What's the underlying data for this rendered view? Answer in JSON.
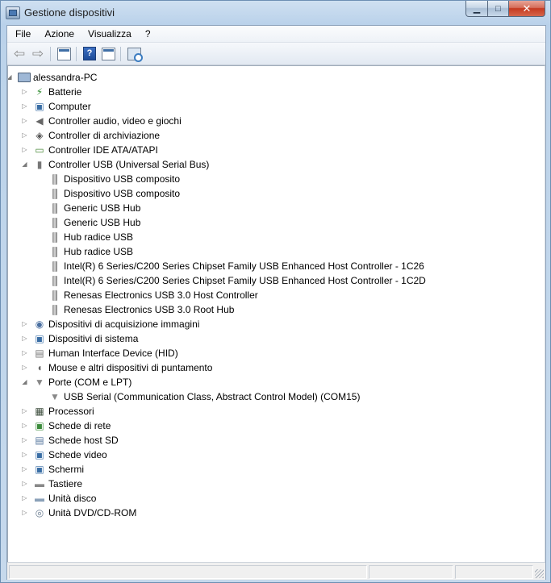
{
  "window": {
    "title": "Gestione dispositivi"
  },
  "caption": {
    "minimize": "▁",
    "maximize": "□",
    "close": "✕"
  },
  "menu": [
    "File",
    "Azione",
    "Visualizza",
    "?"
  ],
  "toolbar": [
    "back-arrow-icon",
    "forward-arrow-icon",
    "show-hide-console-tree-icon",
    "help-icon",
    "properties-icon",
    "scan-hardware-icon"
  ],
  "tree": {
    "root": "alessandra-PC",
    "categories": [
      {
        "label": "Batterie",
        "icon": "battery-icon",
        "expanded": false
      },
      {
        "label": "Computer",
        "icon": "computer-icon",
        "expanded": false
      },
      {
        "label": "Controller audio, video e giochi",
        "icon": "speaker-icon",
        "expanded": false
      },
      {
        "label": "Controller di archiviazione",
        "icon": "storage-controller-icon",
        "expanded": false
      },
      {
        "label": "Controller IDE ATA/ATAPI",
        "icon": "ide-controller-icon",
        "expanded": false
      },
      {
        "label": "Controller USB (Universal Serial Bus)",
        "icon": "usb-icon",
        "expanded": true,
        "children": [
          "Dispositivo USB composito",
          "Dispositivo USB composito",
          "Generic USB Hub",
          "Generic USB Hub",
          "Hub radice USB",
          "Hub radice USB",
          "Intel(R) 6 Series/C200 Series Chipset Family USB Enhanced Host Controller - 1C26",
          "Intel(R) 6 Series/C200 Series Chipset Family USB Enhanced Host Controller - 1C2D",
          "Renesas Electronics USB 3.0 Host Controller",
          "Renesas Electronics USB 3.0 Root Hub"
        ]
      },
      {
        "label": "Dispositivi di acquisizione immagini",
        "icon": "camera-icon",
        "expanded": false
      },
      {
        "label": "Dispositivi di sistema",
        "icon": "system-device-icon",
        "expanded": false
      },
      {
        "label": "Human Interface Device (HID)",
        "icon": "hid-icon",
        "expanded": false
      },
      {
        "label": "Mouse e altri dispositivi di puntamento",
        "icon": "mouse-icon",
        "expanded": false
      },
      {
        "label": "Porte (COM e LPT)",
        "icon": "port-icon",
        "expanded": true,
        "children": [
          "USB Serial (Communication Class, Abstract Control Model) (COM15)"
        ]
      },
      {
        "label": "Processori",
        "icon": "processor-icon",
        "expanded": false
      },
      {
        "label": "Schede di rete",
        "icon": "network-adapter-icon",
        "expanded": false
      },
      {
        "label": "Schede host SD",
        "icon": "sd-host-icon",
        "expanded": false
      },
      {
        "label": "Schede video",
        "icon": "display-adapter-icon",
        "expanded": false
      },
      {
        "label": "Schermi",
        "icon": "monitor-icon",
        "expanded": false
      },
      {
        "label": "Tastiere",
        "icon": "keyboard-icon",
        "expanded": false
      },
      {
        "label": "Unità disco",
        "icon": "disk-drive-icon",
        "expanded": false
      },
      {
        "label": "Unità DVD/CD-ROM",
        "icon": "dvd-drive-icon",
        "expanded": false
      }
    ]
  }
}
